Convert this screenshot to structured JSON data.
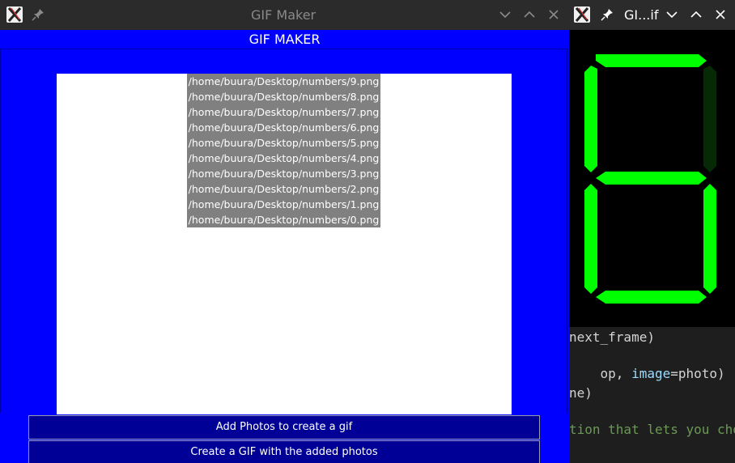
{
  "main_window": {
    "title": "GIF Maker",
    "header": "GIF MAKER",
    "files": [
      "/home/buura/Desktop/numbers/9.png",
      "/home/buura/Desktop/numbers/8.png",
      "/home/buura/Desktop/numbers/7.png",
      "/home/buura/Desktop/numbers/6.png",
      "/home/buura/Desktop/numbers/5.png",
      "/home/buura/Desktop/numbers/4.png",
      "/home/buura/Desktop/numbers/3.png",
      "/home/buura/Desktop/numbers/2.png",
      "/home/buura/Desktop/numbers/1.png",
      "/home/buura/Desktop/numbers/0.png"
    ],
    "buttons": {
      "add": "Add Photos to create a gif",
      "create": "Create a GIF with the added photos"
    }
  },
  "preview_window": {
    "title": "GI...if",
    "digit_color": "#00ff00"
  },
  "code_editor": {
    "line1": "next_frame)",
    "line2_pre": "op, ",
    "line2_param": "image",
    "line2_post": "=photo)",
    "line3": "ne)",
    "line4_comment": "tion that lets you cho"
  },
  "colors": {
    "app_background": "#0000ff",
    "button_background": "#000096",
    "list_selection": "#808080"
  }
}
